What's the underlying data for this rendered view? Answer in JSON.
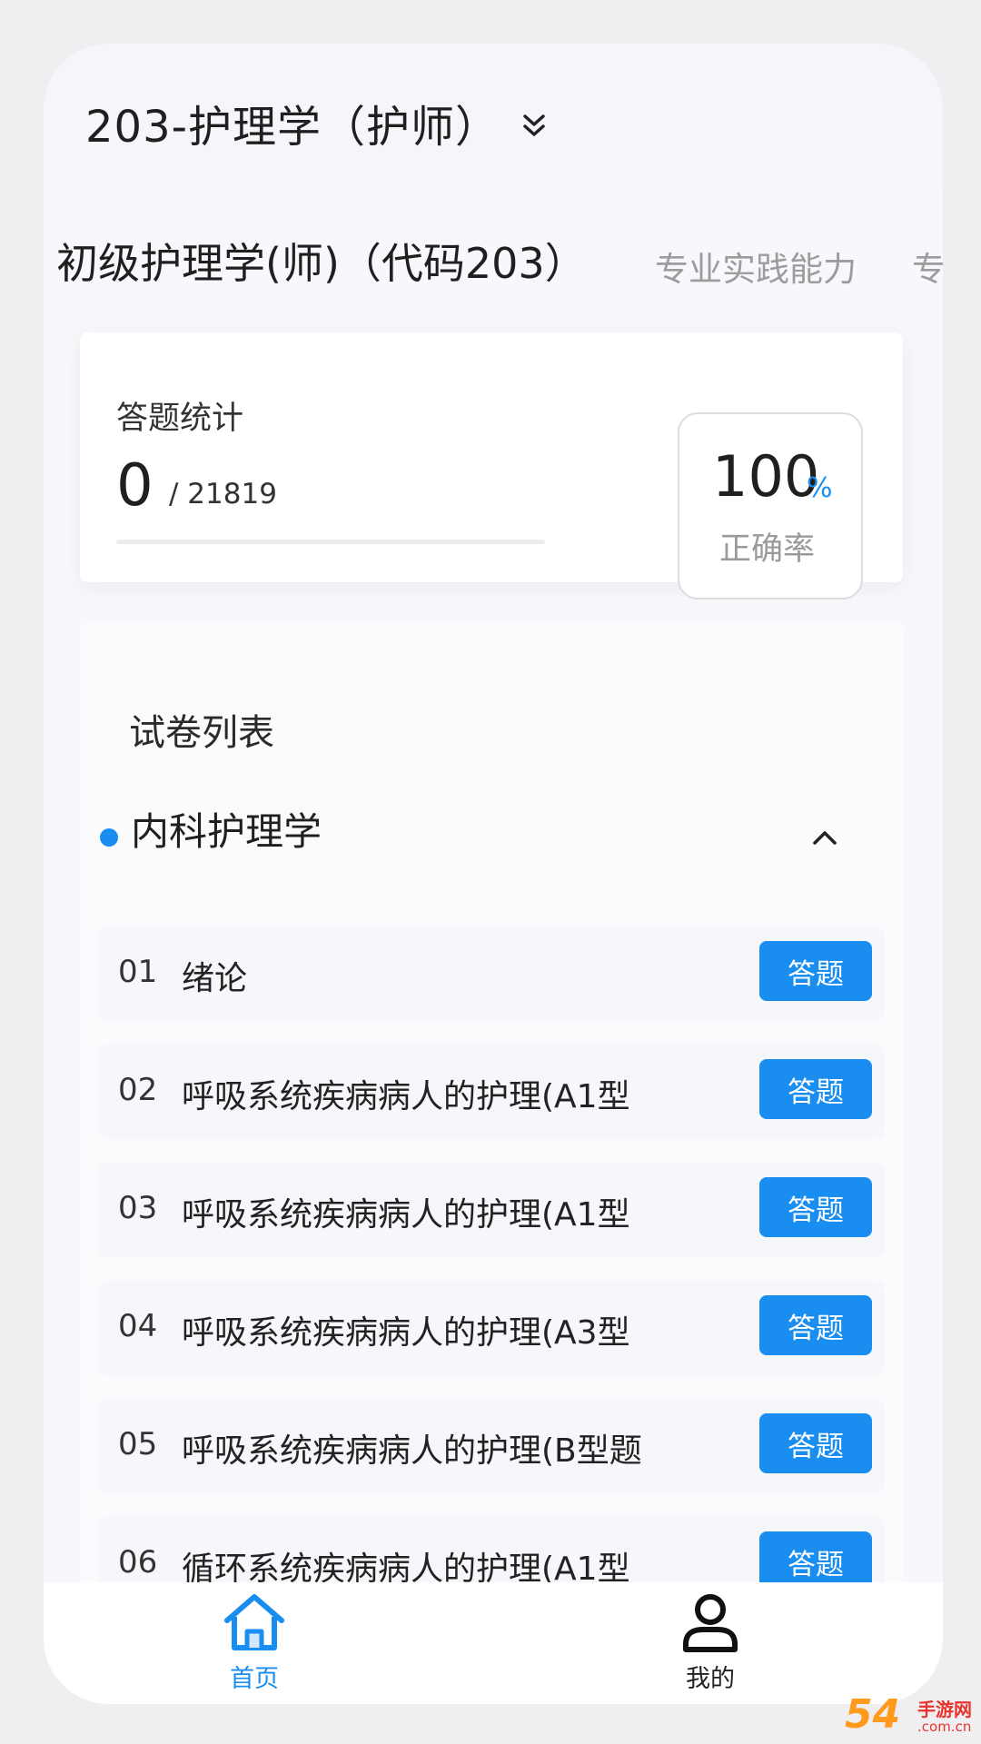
{
  "header": {
    "title": "203-护理学（护师）"
  },
  "tabs": [
    {
      "label": "初级护理学(师)（代码203）"
    },
    {
      "label": "专业实践能力"
    },
    {
      "label": "专"
    }
  ],
  "stats": {
    "label": "答题统计",
    "answered": "0",
    "total": "/ 21819",
    "progress": 0,
    "accuracy_value": "100",
    "accuracy_unit": "%",
    "accuracy_label": "正确率"
  },
  "paper_list": {
    "title": "试卷列表",
    "section_title": "内科护理学",
    "items": [
      {
        "num": "01",
        "title": "绪论",
        "button": "答题"
      },
      {
        "num": "02",
        "title": "呼吸系统疾病病人的护理(A1型",
        "button": "答题"
      },
      {
        "num": "03",
        "title": "呼吸系统疾病病人的护理(A1型",
        "button": "答题"
      },
      {
        "num": "04",
        "title": "呼吸系统疾病病人的护理(A3型",
        "button": "答题"
      },
      {
        "num": "05",
        "title": "呼吸系统疾病病人的护理(B型题",
        "button": "答题"
      },
      {
        "num": "06",
        "title": "循环系统疾病病人的护理(A1型",
        "button": "答题"
      }
    ]
  },
  "bottom_nav": {
    "home": {
      "label": "首页",
      "icon": "home-icon"
    },
    "mine": {
      "label": "我的",
      "icon": "user-icon"
    }
  },
  "colors": {
    "accent": "#1a8ef0"
  },
  "watermark": {
    "number": "54",
    "line1": "手游网",
    "line2": ".com.cn"
  }
}
